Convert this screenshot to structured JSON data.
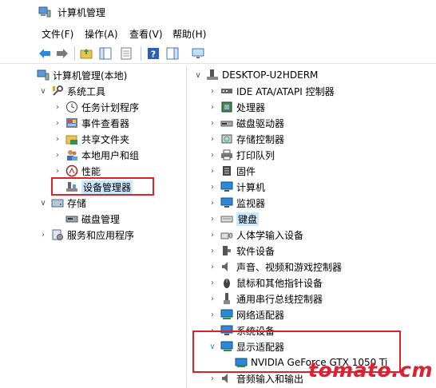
{
  "window": {
    "title": "计算机管理"
  },
  "menu": [
    "文件(F)",
    "操作(A)",
    "查看(V)",
    "帮助(H)"
  ],
  "toolbar_icons": [
    "back-arrow-icon",
    "forward-arrow-icon",
    "up-folder-icon",
    "show-hide-tree-icon",
    "properties-icon",
    "help-icon",
    "show-pane-icon",
    "monitor-icon"
  ],
  "left_tree": {
    "root": "计算机管理(本地)",
    "system_tools": "系统工具",
    "task_scheduler": "任务计划程序",
    "event_viewer": "事件查看器",
    "shared_folders": "共享文件夹",
    "local_users": "本地用户和组",
    "performance": "性能",
    "device_manager": "设备管理器",
    "storage": "存储",
    "disk_management": "磁盘管理",
    "services": "服务和应用程序"
  },
  "right_tree": {
    "computer": "DESKTOP-U2HDERM",
    "categories": [
      "IDE ATA/ATAPI 控制器",
      "处理器",
      "磁盘驱动器",
      "存储控制器",
      "打印队列",
      "固件",
      "计算机",
      "监视器",
      "键盘",
      "人体学输入设备",
      "软件设备",
      "声音、视频和游戏控制器",
      "鼠标和其他指针设备",
      "通用串行总线控制器",
      "网络适配器",
      "系统设备",
      "显示适配器"
    ],
    "gpu": "NVIDIA GeForce GTX 1050 Ti",
    "partial_bottom": "音频输入和输出"
  },
  "watermark": "tomato.cm",
  "colors": {
    "highlight": "#d9232a",
    "selection": "#cce8ff",
    "watermark": "#e02030"
  }
}
